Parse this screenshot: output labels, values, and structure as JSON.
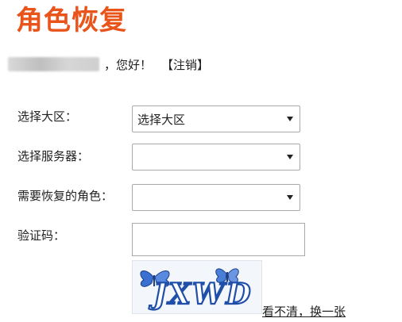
{
  "page_title": "角色恢复",
  "greeting": {
    "suffix": "，您好！",
    "logout_label": "【注销】"
  },
  "form": {
    "region": {
      "label": "选择大区：",
      "selected": "选择大区"
    },
    "server": {
      "label": "选择服务器：",
      "selected": ""
    },
    "role": {
      "label": "需要恢复的角色：",
      "selected": ""
    },
    "captcha": {
      "label": "验证码：",
      "value": "",
      "image_text": "JXWD",
      "refresh_label": "看不清，换一张"
    }
  },
  "colors": {
    "title": "#e8541a",
    "captcha_text": "#1f4fa8"
  },
  "icons": [
    "dropdown-arrow-icon",
    "butterfly-icon"
  ]
}
